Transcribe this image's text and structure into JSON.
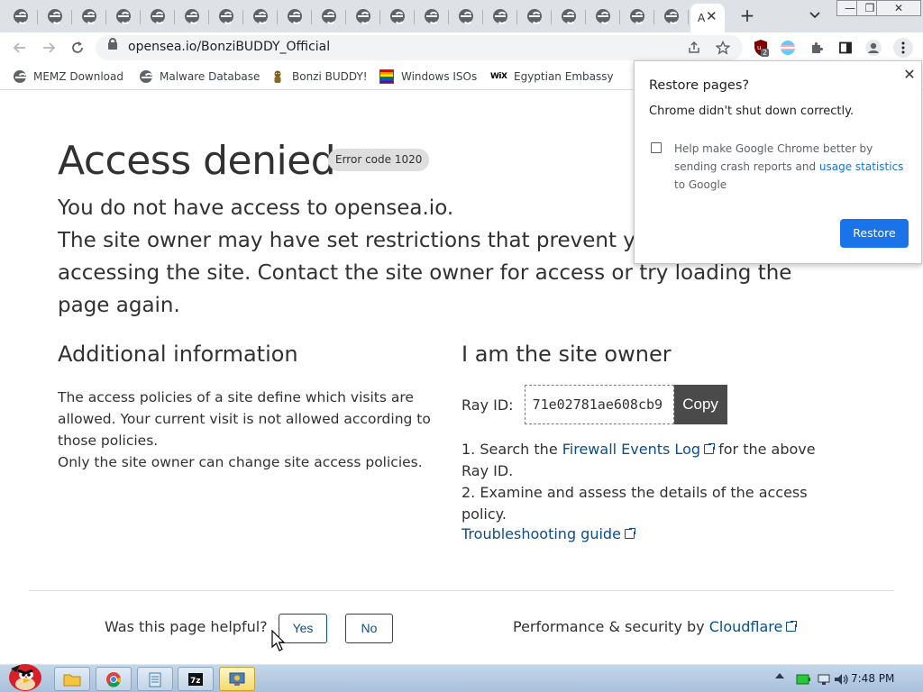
{
  "browser": {
    "active_tab_text": "A",
    "url": "opensea.io/BonziBUDDY_Official",
    "extension_badge": "2",
    "bookmarks": [
      {
        "label": "MEMZ Download",
        "icon": "globe-icon"
      },
      {
        "label": "Malware Database",
        "icon": "globe-icon"
      },
      {
        "label": "Bonzi BUDDY!",
        "icon": "bonzi-icon"
      },
      {
        "label": "Windows ISOs",
        "icon": "rainbow-flag-icon"
      },
      {
        "label": "Egyptian Embassy",
        "icon": "wix-icon"
      }
    ],
    "wix_text": "WiX"
  },
  "page": {
    "heading": "Access denied",
    "error_code": "Error code 1020",
    "lead_line1": "You do not have access to opensea.io.",
    "lead_line2": "The site owner may have set restrictions that prevent you from accessing the site. Contact the site owner for access or try loading the page again.",
    "additional": {
      "title": "Additional information",
      "text1": "The access policies of a site define which visits are allowed. Your current visit is not allowed according to those policies.",
      "text2": "Only the site owner can change site access policies."
    },
    "owner": {
      "title": "I am the site owner",
      "ray_label": "Ray ID:",
      "ray_id": "71e02781ae608cb9",
      "copy_label": "Copy",
      "step1_pre": "1. Search the ",
      "step1_link": "Firewall Events Log",
      "step1_post": " for the above Ray ID.",
      "step2": "2. Examine and assess the details of the access policy.",
      "troubleshooting": "Troubleshooting guide"
    },
    "footer": {
      "helpful": "Was this page helpful?",
      "yes": "Yes",
      "no": "No",
      "perf_pre": "Performance & security by ",
      "perf_link": "Cloudflare"
    }
  },
  "popup": {
    "title": "Restore pages?",
    "message": "Chrome didn't shut down correctly.",
    "help_pre": "Help make Google Chrome better by sending crash reports and ",
    "help_link": "usage statistics",
    "help_post": " to Google",
    "restore_label": "Restore"
  },
  "taskbar": {
    "clock": "7:48 PM"
  },
  "colors": {
    "link": "#0c4d8c",
    "chrome_blue": "#1a73e8",
    "copy_button": "#4a4a4a"
  }
}
